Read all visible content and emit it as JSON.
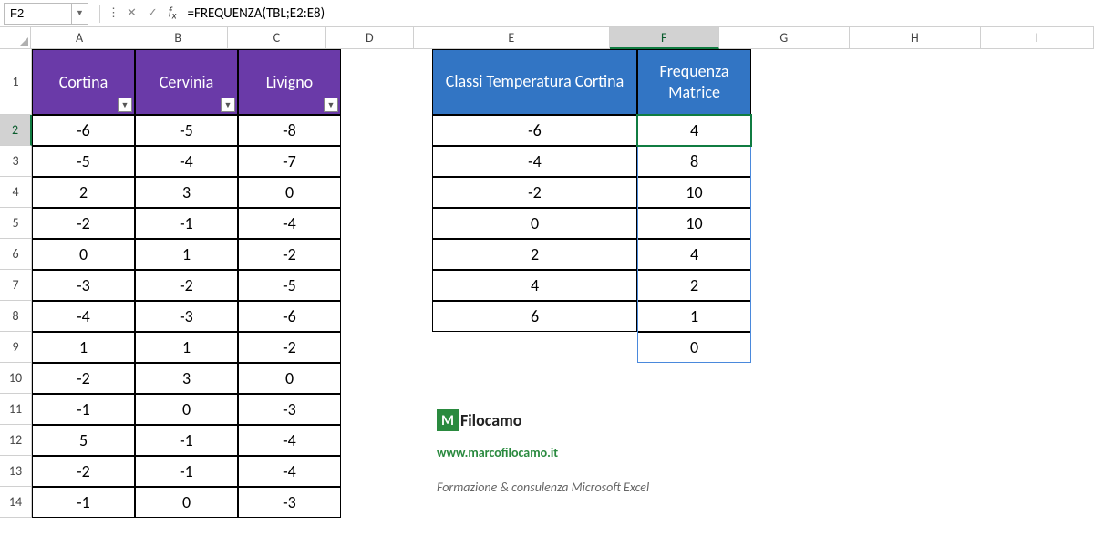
{
  "formulaBar": {
    "nameBox": "F2",
    "formula": "=FREQUENZA(TBL;E2:E8)"
  },
  "columns": [
    "A",
    "B",
    "C",
    "D",
    "E",
    "F",
    "G",
    "H",
    "I"
  ],
  "activeColumn": "F",
  "rows": [
    "1",
    "2",
    "3",
    "4",
    "5",
    "6",
    "7",
    "8",
    "9",
    "10",
    "11",
    "12",
    "13",
    "14"
  ],
  "activeRow": "2",
  "table1": {
    "headers": [
      "Cortina",
      "Cervinia",
      "Livigno"
    ],
    "rows": [
      [
        "-6",
        "-5",
        "-8"
      ],
      [
        "-5",
        "-4",
        "-7"
      ],
      [
        "2",
        "3",
        "0"
      ],
      [
        "-2",
        "-1",
        "-4"
      ],
      [
        "0",
        "1",
        "-2"
      ],
      [
        "-3",
        "-2",
        "-5"
      ],
      [
        "-4",
        "-3",
        "-6"
      ],
      [
        "1",
        "1",
        "-2"
      ],
      [
        "-2",
        "3",
        "0"
      ],
      [
        "-1",
        "0",
        "-3"
      ],
      [
        "5",
        "-1",
        "-4"
      ],
      [
        "-2",
        "-1",
        "-4"
      ],
      [
        "-1",
        "0",
        "-3"
      ]
    ]
  },
  "table2": {
    "headerE": "Classi Temperatura Cortina",
    "headerF": "Frequenza Matrice",
    "dataE": [
      "-6",
      "-4",
      "-2",
      "0",
      "2",
      "4",
      "6"
    ],
    "dataF": [
      "4",
      "8",
      "10",
      "10",
      "4",
      "2",
      "1",
      "0"
    ]
  },
  "branding": {
    "logoLetter": "M",
    "logoText": "Filocamo",
    "url": "www.marcofilocamo.it",
    "tagline": "Formazione & consulenza Microsoft Excel"
  }
}
